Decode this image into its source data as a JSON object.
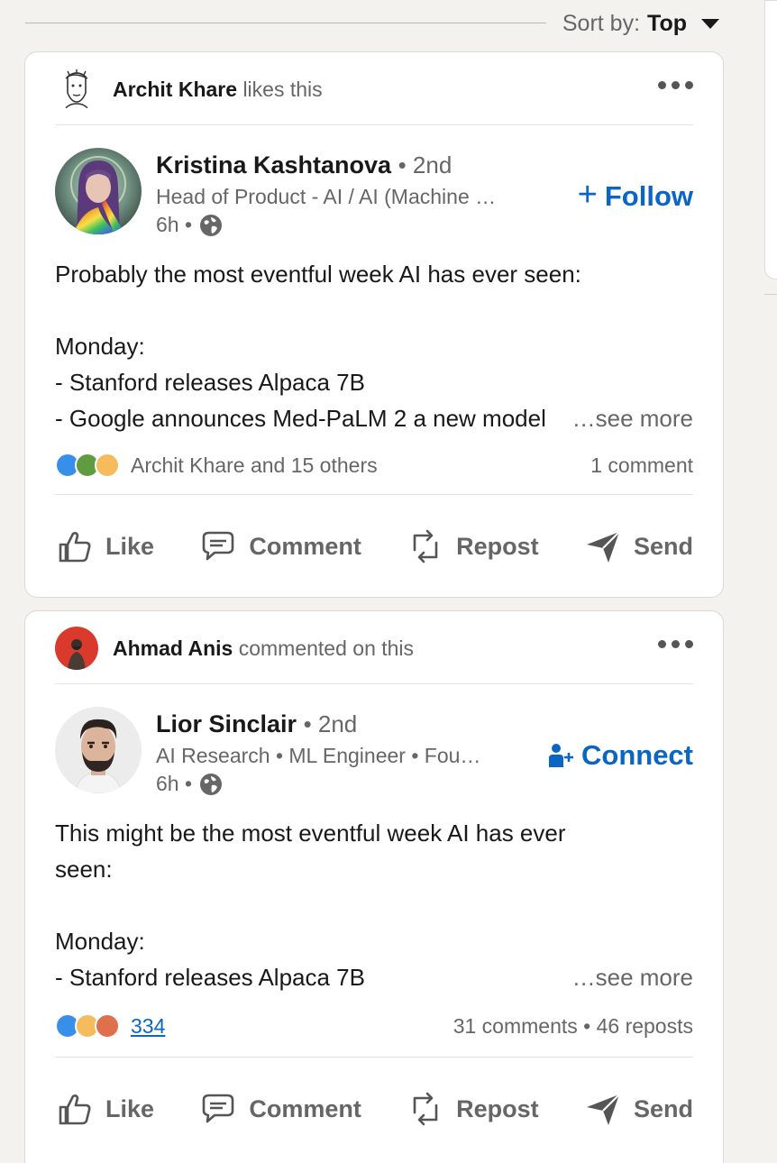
{
  "sort": {
    "label": "Sort by:",
    "value": "Top"
  },
  "posts": [
    {
      "context": {
        "name": "Archit Khare",
        "action": "likes this"
      },
      "author": {
        "name": "Kristina Kashtanova",
        "degree": "• 2nd",
        "headline": "Head of Product - AI / AI (Machine …",
        "time": "6h •"
      },
      "cta": {
        "icon": "+",
        "label": "Follow"
      },
      "body": [
        "Probably the most eventful week AI has ever seen:",
        "",
        "Monday:",
        "- Stanford releases Alpaca 7B",
        "- Google announces Med-PaLM 2 a new model"
      ],
      "see_more": "…see more",
      "reactions_text": "Archit Khare and 15 others",
      "stats_right": "1 comment"
    },
    {
      "context": {
        "name": "Ahmad Anis",
        "action": "commented on this"
      },
      "author": {
        "name": "Lior Sinclair",
        "degree": "• 2nd",
        "headline": "AI Research • ML Engineer • Fou…",
        "time": "6h •"
      },
      "cta": {
        "icon": "",
        "label": "Connect"
      },
      "body": [
        "This might be the most eventful week AI has ever",
        "seen:",
        "",
        "Monday:",
        "- Stanford releases Alpaca 7B"
      ],
      "see_more": "…see more",
      "reactions_text": "334",
      "stats_right": "31 comments • 46 reposts"
    }
  ],
  "actions": {
    "like": "Like",
    "comment": "Comment",
    "repost": "Repost",
    "send": "Send"
  },
  "colors": {
    "accent": "#0a66c2",
    "muted": "#666666",
    "background": "#f3f2ef"
  }
}
